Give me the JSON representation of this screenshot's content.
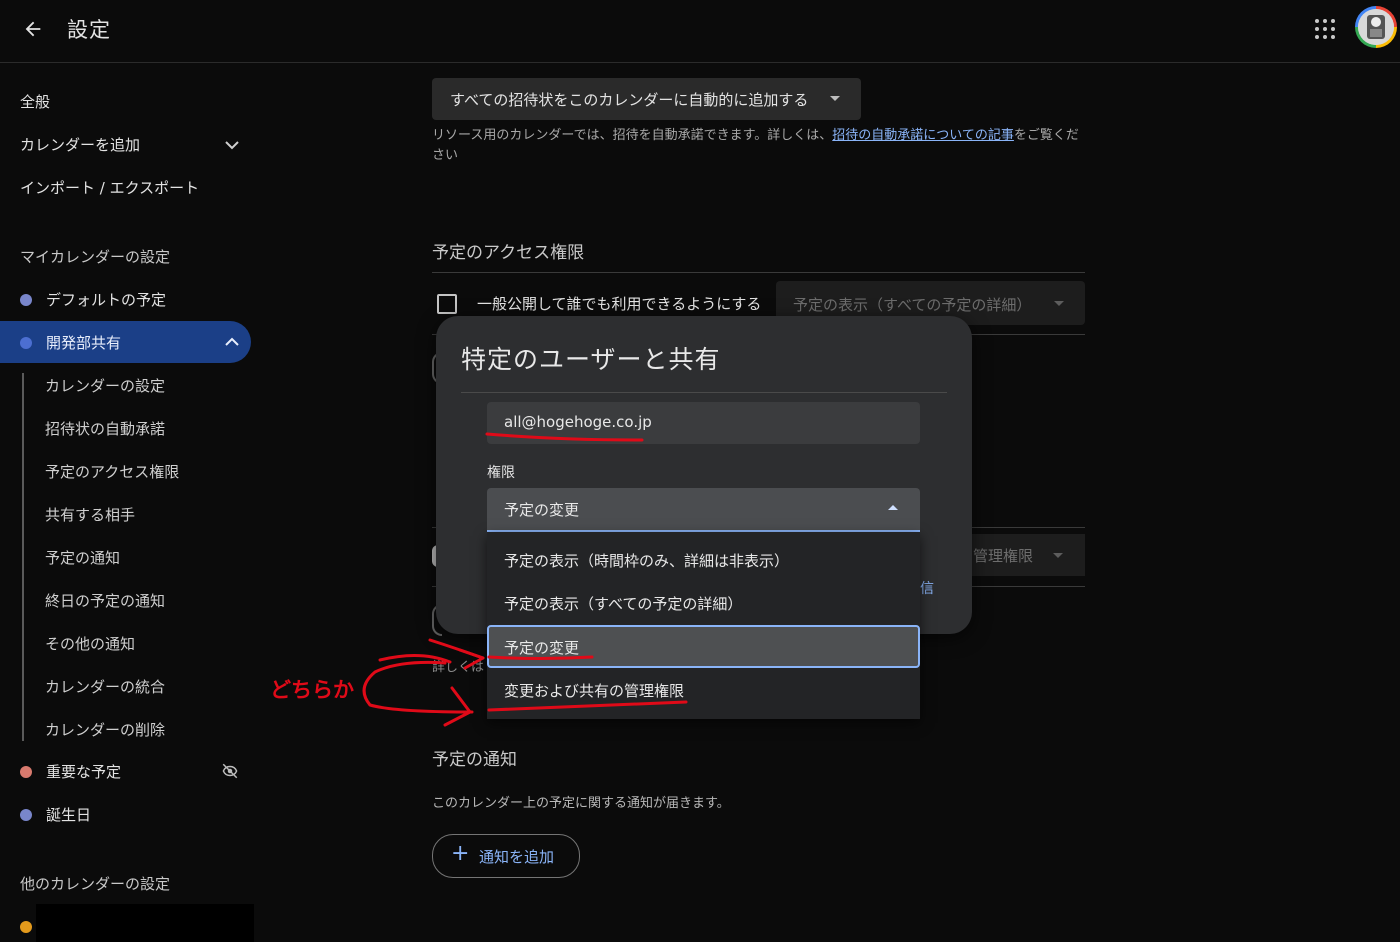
{
  "header": {
    "title": "設定",
    "back_icon": "arrow-back-icon",
    "apps_icon": "apps-grid-icon"
  },
  "sidebar": {
    "general": "全般",
    "add_calendar": "カレンダーを追加",
    "import_export": "インポート / エクスポート",
    "my_calendars_heading": "マイカレンダーの設定",
    "default_events": "デフォルトの予定",
    "dev_shared": "開発部共有",
    "sub_items": [
      "カレンダーの設定",
      "招待状の自動承諾",
      "予定のアクセス権限",
      "共有する相手",
      "予定の通知",
      "終日の予定の通知",
      "その他の通知",
      "カレンダーの統合",
      "カレンダーの削除"
    ],
    "important_events": "重要な予定",
    "birthdays": "誕生日",
    "other_calendars_heading": "他のカレンダーの設定",
    "colors": {
      "default": "#7986cb",
      "dev": "#4c6fd1",
      "important": "#d87a6e",
      "birthday": "#7986cb",
      "other": "#e39a1c",
      "active_bg": "#1b3f87"
    }
  },
  "main": {
    "auto_accept_select": "すべての招待状をこのカレンダーに自動的に追加する",
    "help_text_before": "リソース用のカレンダーでは、招待を自動承諾できます。詳しくは、",
    "help_link": "招待の自動承諾についての記事",
    "help_text_after": "をご覧ください",
    "access_title": "予定のアクセス権限",
    "public_checkbox_label": "一般公開して誰でも利用できるようにする",
    "public_select_value": "予定の表示（すべての予定の詳細）",
    "partial_permission": "管理権限",
    "partial_detail": "詳しくは",
    "notifications_title": "予定の通知",
    "notifications_desc": "このカレンダー上の予定に関する通知が届きます。",
    "add_notification": "通知を追加"
  },
  "dialog": {
    "title": "特定のユーザーと共有",
    "email_value": "all@hogehoge.co.jp",
    "permission_label": "権限",
    "permission_selected": "予定の変更",
    "options": [
      "予定の表示（時間枠のみ、詳細は非表示）",
      "予定の表示（すべての予定の詳細）",
      "予定の変更",
      "変更および共有の管理権限"
    ]
  },
  "annotation": {
    "text": "どちらか",
    "color": "#e00a18"
  }
}
